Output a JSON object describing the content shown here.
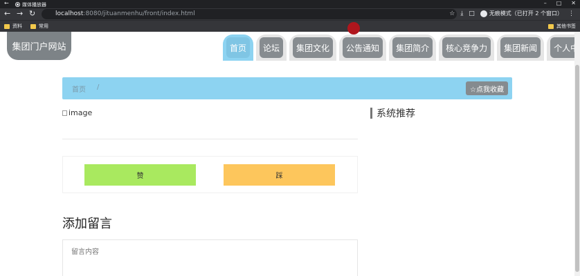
{
  "browser": {
    "tab_title": "媒体播放器",
    "url_host": "localhost",
    "url_rest": ":8080/jituanmenhu/front/index.html",
    "incognito_label": "无痕模式（已打开 2 个窗口）",
    "bookmarks": [
      "资料",
      "常用"
    ],
    "other_bookmarks": "其他书签",
    "icons": {
      "back": "←",
      "forward": "→",
      "reload": "↻",
      "star": "☆",
      "download": "⤓",
      "window": "□",
      "more": "⋮",
      "minimize": "–",
      "maximize": "□",
      "close": "✕"
    }
  },
  "site": {
    "logo": "集团门户网站",
    "nav": [
      {
        "label": "首页",
        "active": true
      },
      {
        "label": "论坛"
      },
      {
        "label": "集团文化"
      },
      {
        "label": "公告通知"
      },
      {
        "label": "集团简介"
      },
      {
        "label": "核心竞争力"
      },
      {
        "label": "集团新闻"
      },
      {
        "label": "个人中心"
      }
    ],
    "breadcrumb": {
      "home": "首页",
      "separator": "/"
    },
    "favorite_button": "☆点我收藏",
    "image_alt": "image",
    "like_button": "赞",
    "dislike_button": "踩",
    "message_title": "添加留言",
    "message_placeholder": "留言内容",
    "sidebar_title": "系统推荐"
  },
  "colors": {
    "accent": "#8dd3f1",
    "nav_bg": "#e5e5e5",
    "nav_label": "#878c90",
    "like": "#a9e95f",
    "dislike": "#fdc65c"
  }
}
